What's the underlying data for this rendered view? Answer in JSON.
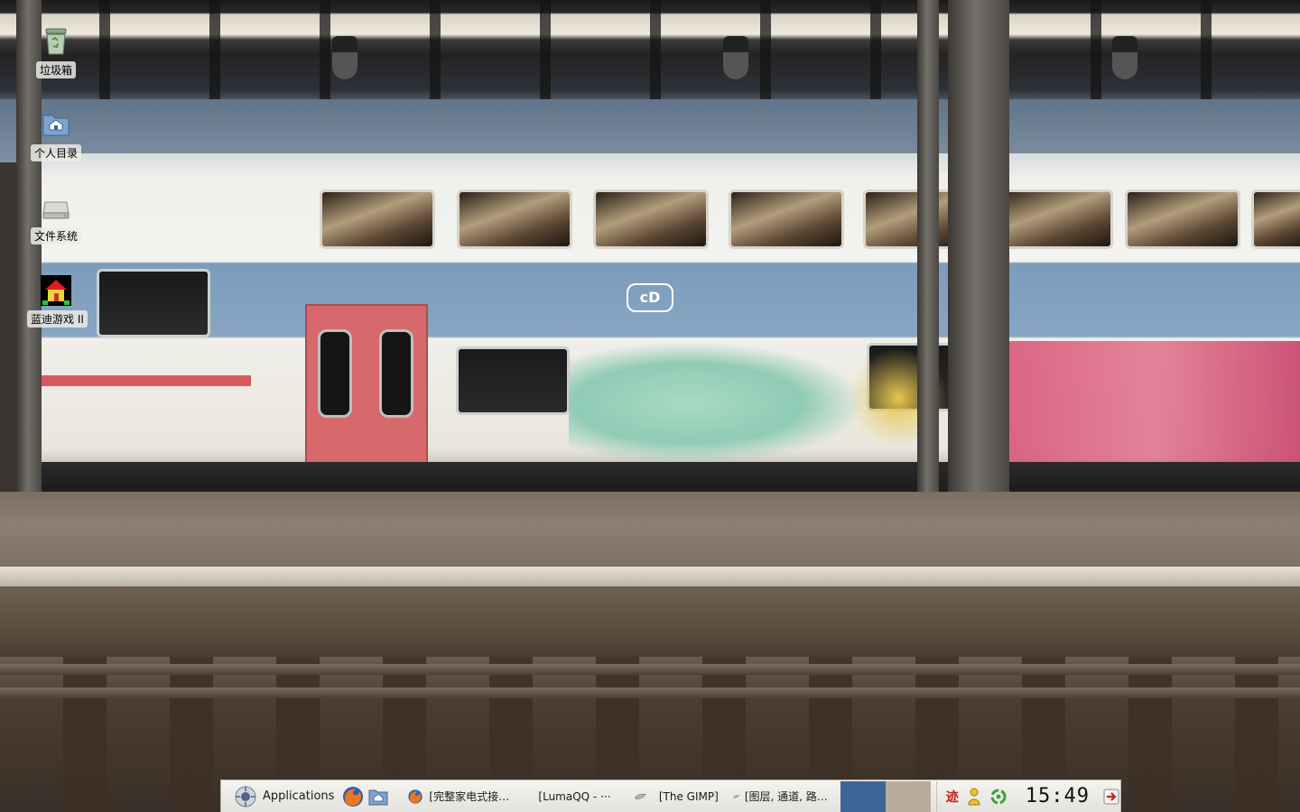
{
  "desktop": {
    "icons": [
      {
        "label": "垃圾箱",
        "icon": "trash-icon"
      },
      {
        "label": "个人目录",
        "icon": "home-folder-icon"
      },
      {
        "label": "文件系统",
        "icon": "harddisk-icon"
      },
      {
        "label": "蓝迪游戏 II",
        "icon": "game-house-icon"
      }
    ]
  },
  "panel": {
    "applications_label": "Applications",
    "launchers": [
      {
        "icon": "firefox-icon"
      },
      {
        "icon": "home-folder-icon"
      }
    ],
    "tasks": [
      {
        "label": "[完整家电式接…",
        "icon": "firefox-icon"
      },
      {
        "label": "[LumaQQ - ···",
        "icon": ""
      },
      {
        "label": "[The GIMP]",
        "icon": "gimp-icon"
      },
      {
        "label": "[图层, 通道, 路…",
        "icon": "gimp-icon"
      }
    ],
    "workspaces": [
      {
        "color": "#3d6596",
        "active": true
      },
      {
        "color": "#b8ad9c",
        "active": false
      }
    ],
    "tray": [
      {
        "label": "迹",
        "icon": "input-method-icon",
        "color": "#c0201c"
      },
      {
        "icon": "user-status-icon"
      },
      {
        "icon": "update-icon"
      }
    ],
    "clock": "15:49",
    "logout_icon": "logout-icon"
  }
}
